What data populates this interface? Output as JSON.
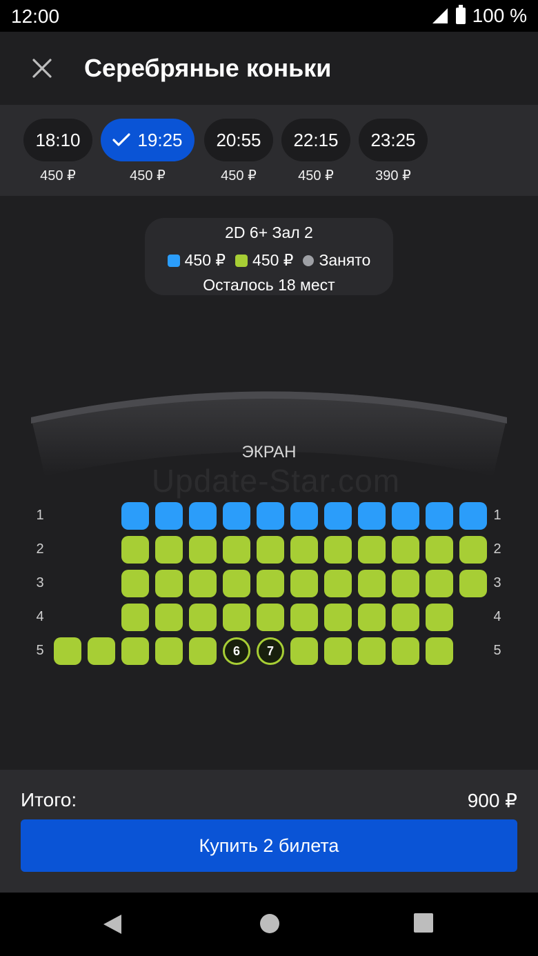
{
  "status_bar": {
    "time": "12:00",
    "battery": "100 %",
    "icons": [
      "signal-icon",
      "battery-icon"
    ]
  },
  "header": {
    "close_icon": "close-icon",
    "title": "Серебряные коньки"
  },
  "sessions": [
    {
      "time": "18:10",
      "price": "450 ₽",
      "selected": false
    },
    {
      "time": "19:25",
      "price": "450 ₽",
      "selected": true
    },
    {
      "time": "20:55",
      "price": "450 ₽",
      "selected": false
    },
    {
      "time": "22:15",
      "price": "450 ₽",
      "selected": false
    },
    {
      "time": "23:25",
      "price": "390 ₽",
      "selected": false
    }
  ],
  "info": {
    "format": "2D 6+ Зал 2",
    "legend": [
      {
        "label": "450 ₽",
        "color": "#2b9dfa"
      },
      {
        "label": "450 ₽",
        "color": "#a7ce35"
      },
      {
        "label": "Занято",
        "color": "#9ea0a5"
      }
    ],
    "remaining": "Осталось 18 мест"
  },
  "screen_label": "ЭКРАН",
  "watermark": "Update-Star.com",
  "seat_rows": [
    {
      "row": "1",
      "first_seat": 3,
      "count": 11,
      "color": "blue",
      "selected": []
    },
    {
      "row": "2",
      "first_seat": 3,
      "count": 11,
      "color": "green",
      "selected": []
    },
    {
      "row": "3",
      "first_seat": 3,
      "count": 11,
      "color": "green",
      "selected": []
    },
    {
      "row": "4",
      "first_seat": 3,
      "count": 10,
      "color": "green",
      "selected": []
    },
    {
      "row": "5",
      "first_seat": 1,
      "count": 12,
      "color": "green",
      "selected": [
        {
          "index": 6,
          "label": "6"
        },
        {
          "index": 7,
          "label": "7"
        }
      ]
    }
  ],
  "checkout": {
    "total_label": "Итого:",
    "total_value": "900 ₽",
    "buy_label": "Купить 2 билета"
  },
  "nav": {
    "back_icon": "back-icon",
    "home_icon": "home-icon",
    "recents_icon": "recents-icon"
  }
}
